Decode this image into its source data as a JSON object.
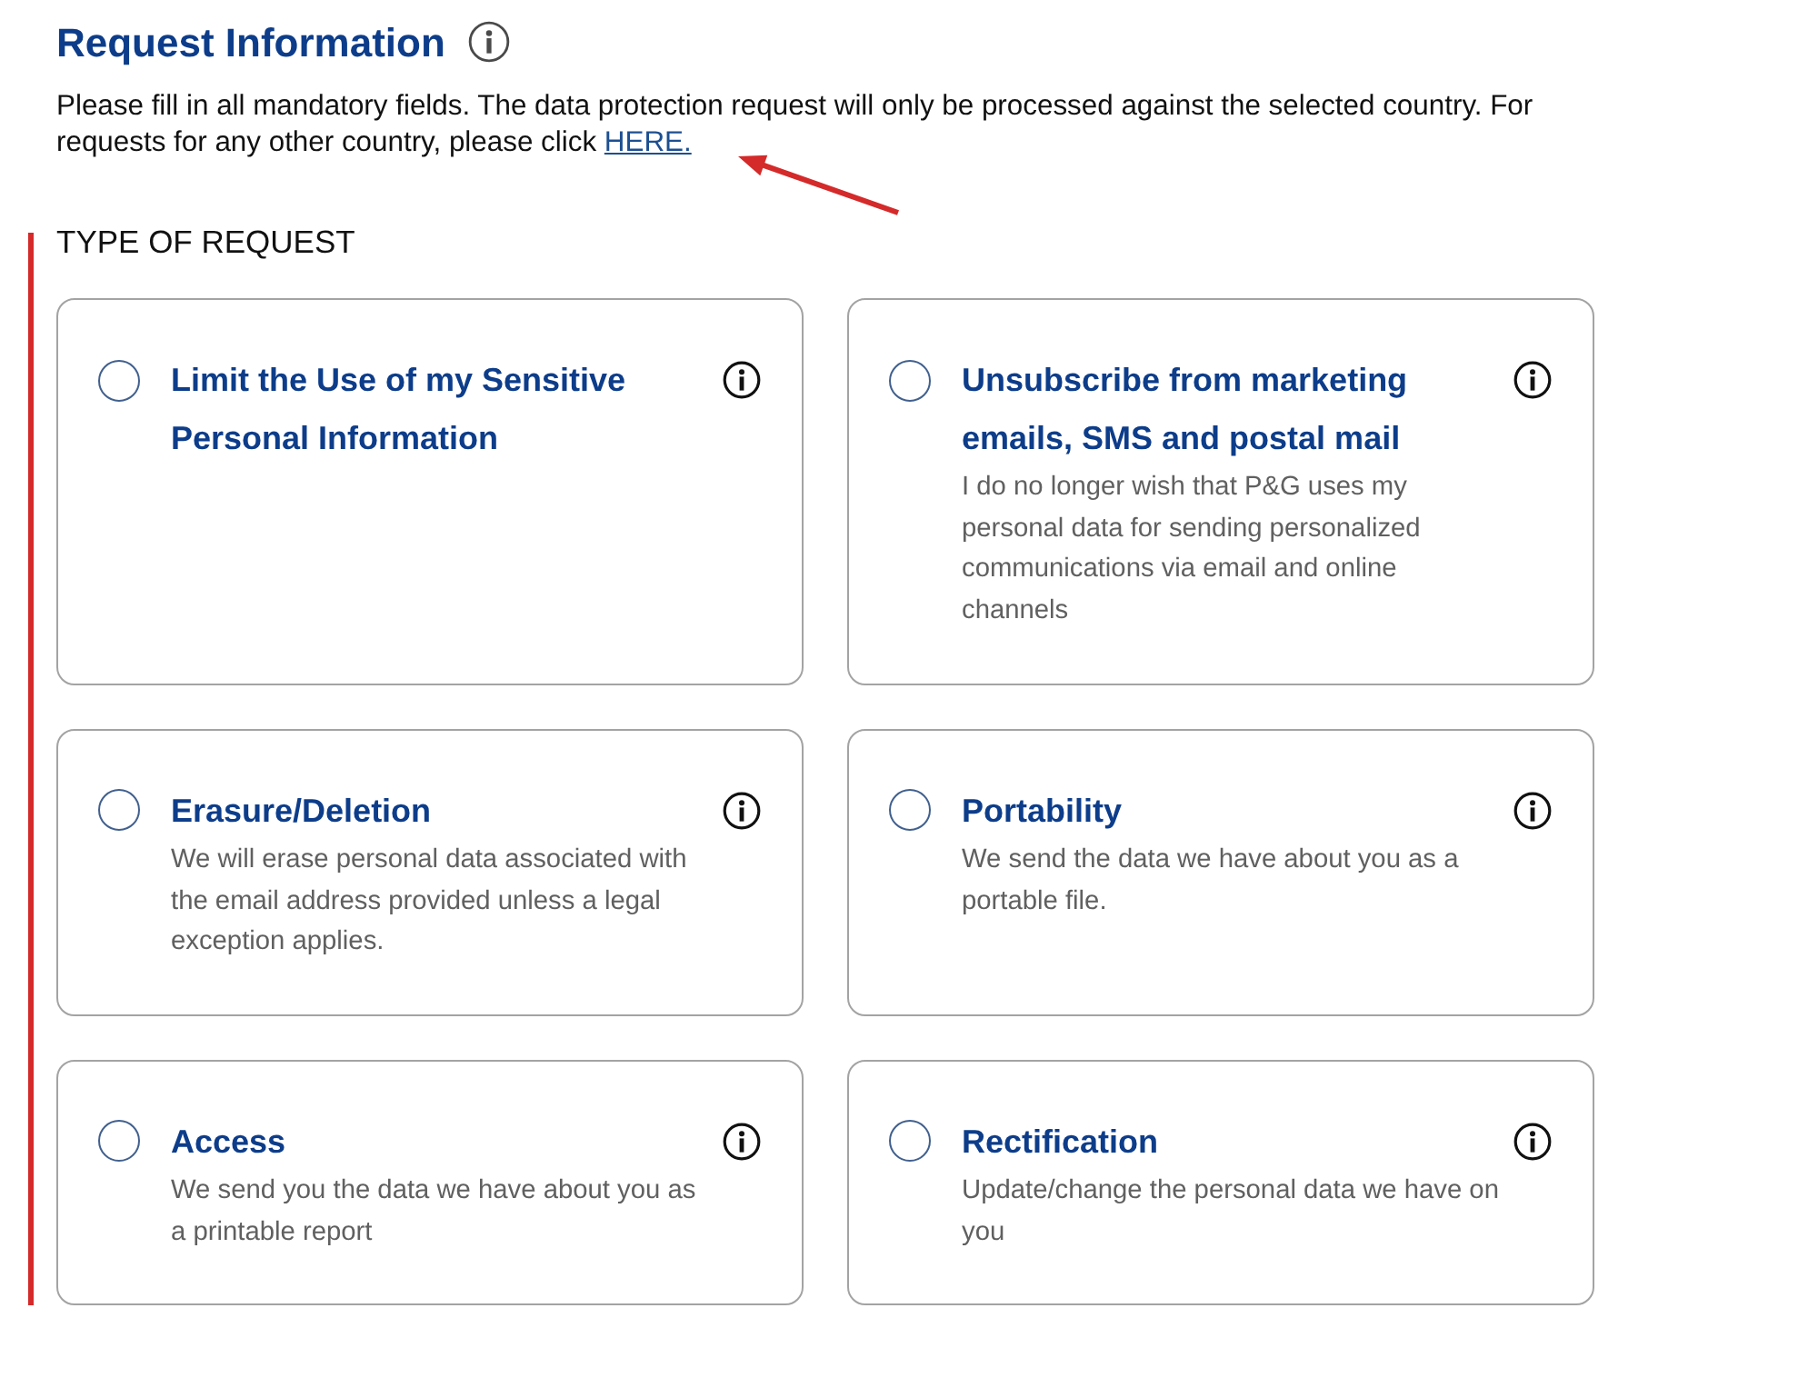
{
  "header": {
    "title": "Request Information"
  },
  "intro": {
    "text": "Please fill in all mandatory fields. The data protection request will only be processed against the selected country. For requests for any other country, please click",
    "link": "HERE."
  },
  "section_label": "TYPE OF REQUEST",
  "options": [
    {
      "title": "Limit the Use of my Sensitive Personal Information",
      "selected": false
    },
    {
      "title": "Unsubscribe from marketing emails, SMS and postal mail",
      "description": "I do no longer wish that P&G uses my personal data for sending personalized communications via email and online channels",
      "selected": false
    },
    {
      "title": "Erasure/Deletion",
      "description": "We will erase personal data associated with the email address provided unless a legal exception applies.",
      "selected": false
    },
    {
      "title": "Portability",
      "description": "We send the data we have about you as a portable file.",
      "selected": false
    },
    {
      "title": "Access",
      "description": "We send you the data we have about you as a printable report",
      "selected": false
    },
    {
      "title": "Rectification",
      "description": "Update/change the personal data we have on you",
      "selected": false
    }
  ],
  "annotations": [
    {
      "kind": "arrow"
    },
    {
      "kind": "line"
    }
  ]
}
